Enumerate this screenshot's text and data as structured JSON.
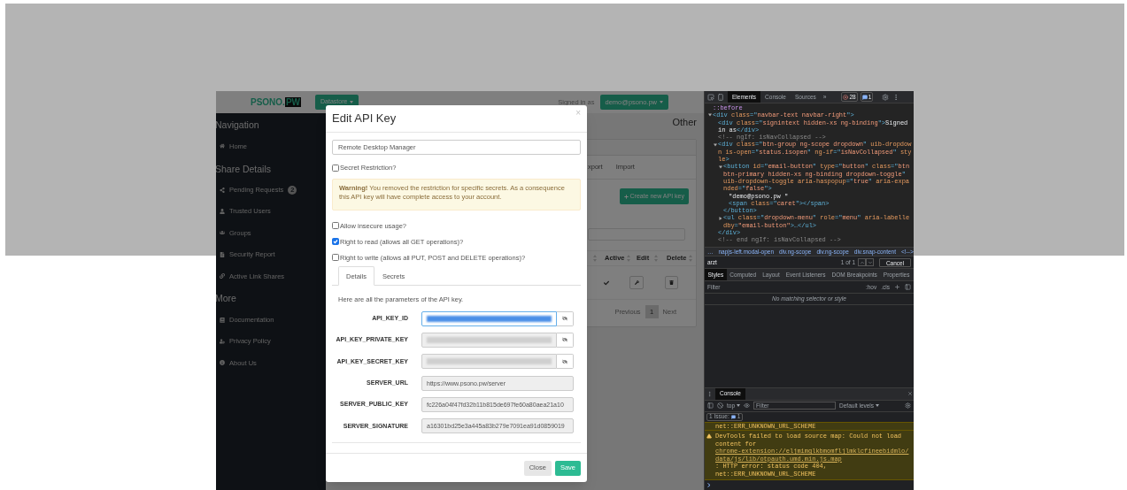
{
  "app": {
    "navbar": {
      "logo_text": "PSONO.",
      "logo_box": "PW",
      "datastore_button": "Datastore",
      "signed_in": "Signed in as",
      "user_button": "demo@psono.pw"
    },
    "sidebar": [
      {
        "title": "Navigation",
        "items": [
          {
            "label": "Home"
          }
        ]
      },
      {
        "title": "Share Details",
        "items": [
          {
            "label": "Pending Requests",
            "badge": "2"
          },
          {
            "label": "Trusted Users"
          },
          {
            "label": "Groups"
          },
          {
            "label": "Security Report"
          },
          {
            "label": "Active Link Shares"
          }
        ]
      },
      {
        "title": "More",
        "items": [
          {
            "label": "Documentation"
          },
          {
            "label": "Privacy Policy"
          },
          {
            "label": "About Us"
          }
        ]
      }
    ],
    "main": {
      "heading": "Other",
      "tabs": [
        "xport",
        "Import"
      ],
      "create_button": "Create new API key",
      "columns": [
        "Active",
        "Edit",
        "Delete"
      ],
      "rows": [
        {
          "active": true
        }
      ],
      "previous": "Previous",
      "page": "1",
      "next": "Next"
    }
  },
  "modal": {
    "title": "Edit API Key",
    "close": "×",
    "name_value": "Remote Desktop Manager",
    "secret_restriction": {
      "label": "Secret Restriction?",
      "checked": false
    },
    "warning": "**Warning!** You removed the restriction for specific secrets. As a consequence this API key will have complete access to your account.",
    "permissions": [
      {
        "label": "Allow insecure usage?",
        "checked": false
      },
      {
        "label": "Right to read (allows all GET operations)?",
        "checked": true
      },
      {
        "label": "Right to write (allows all PUT, POST and DELETE operations)?",
        "checked": false
      }
    ],
    "tabs": [
      {
        "label": "Details",
        "selected": true
      },
      {
        "label": "Secrets",
        "selected": false
      }
    ],
    "intro": "Here are all the parameters of the API key.",
    "params": [
      {
        "label": "API_KEY_ID",
        "kind": "hidden",
        "highlighted": true
      },
      {
        "label": "API_KEY_PRIVATE_KEY",
        "kind": "hidden",
        "highlighted": false
      },
      {
        "label": "API_KEY_SECRET_KEY",
        "kind": "hidden",
        "highlighted": false
      },
      {
        "label": "SERVER_URL",
        "kind": "text",
        "value": "https://www.psono.pw/server"
      },
      {
        "label": "SERVER_PUBLIC_KEY",
        "kind": "text",
        "value": "fc226a04f47fd32b11b815de697fe60a80aea21a10"
      },
      {
        "label": "SERVER_SIGNATURE",
        "kind": "text",
        "value": "a16301bd25e3a445a83b279e7091ea91d0859019"
      }
    ],
    "buttons": [
      {
        "label": "Close",
        "kind": "default"
      },
      {
        "label": "Save",
        "kind": "primary"
      }
    ]
  },
  "devtools": {
    "tabs": [
      {
        "label": "Elements",
        "selected": true
      },
      {
        "label": "Console",
        "selected": false
      },
      {
        "label": "Sources",
        "selected": false
      }
    ],
    "more": "»",
    "errors": "28",
    "messages": "1",
    "dom": [
      {
        "segs": [
          {
            "kind": "pseudo",
            "t": "::before"
          }
        ]
      },
      {
        "expanded": true,
        "segs": [
          {
            "kind": "tag",
            "t": "<div "
          },
          {
            "kind": "attr",
            "t": "class"
          },
          {
            "kind": "tag",
            "t": "=\""
          },
          {
            "kind": "val",
            "t": "navbar-text navbar-right"
          },
          {
            "kind": "tag",
            "t": "\">"
          }
        ],
        "children": [
          {
            "segs": [
              {
                "kind": "tag",
                "t": "<div "
              },
              {
                "kind": "attr",
                "t": "class"
              },
              {
                "kind": "tag",
                "t": "=\""
              },
              {
                "kind": "val",
                "t": "signintext hidden-xs ng-binding"
              },
              {
                "kind": "tag",
                "t": "\">"
              },
              {
                "kind": "text",
                "t": "Signed in as"
              },
              {
                "kind": "tag",
                "t": "</div>"
              }
            ]
          },
          {
            "segs": [
              {
                "kind": "comment",
                "t": "<!-- ngIf: isNavCollapsed -->"
              }
            ]
          },
          {
            "expanded": true,
            "segs": [
              {
                "kind": "tag",
                "t": "<div "
              },
              {
                "kind": "attr",
                "t": "class"
              },
              {
                "kind": "tag",
                "t": "=\""
              },
              {
                "kind": "val",
                "t": "btn-group ng-scope dropdown"
              },
              {
                "kind": "tag",
                "t": "\" "
              },
              {
                "kind": "attr",
                "t": "uib-dropdown is-open"
              },
              {
                "kind": "tag",
                "t": "=\""
              },
              {
                "kind": "val",
                "t": "status.isopen"
              },
              {
                "kind": "tag",
                "t": "\" "
              },
              {
                "kind": "attr",
                "t": "ng-if"
              },
              {
                "kind": "tag",
                "t": "=\""
              },
              {
                "kind": "val",
                "t": "isNavCollapsed"
              },
              {
                "kind": "tag",
                "t": "\" "
              },
              {
                "kind": "attr",
                "t": "style"
              },
              {
                "kind": "tag",
                "t": ">"
              }
            ],
            "children": [
              {
                "expanded": true,
                "segs": [
                  {
                    "kind": "tag",
                    "t": "<button "
                  },
                  {
                    "kind": "attr",
                    "t": "id"
                  },
                  {
                    "kind": "tag",
                    "t": "=\""
                  },
                  {
                    "kind": "val",
                    "t": "email-button"
                  },
                  {
                    "kind": "tag",
                    "t": "\" "
                  },
                  {
                    "kind": "attr",
                    "t": "type"
                  },
                  {
                    "kind": "tag",
                    "t": "=\""
                  },
                  {
                    "kind": "val",
                    "t": "button"
                  },
                  {
                    "kind": "tag",
                    "t": "\" "
                  },
                  {
                    "kind": "attr",
                    "t": "class"
                  },
                  {
                    "kind": "tag",
                    "t": "=\""
                  },
                  {
                    "kind": "val",
                    "t": "btn btn-primary hidden-xs ng-binding dropdown-toggle"
                  },
                  {
                    "kind": "tag",
                    "t": "\" "
                  },
                  {
                    "kind": "attr",
                    "t": "uib-dropdown-toggle aria-haspopup"
                  },
                  {
                    "kind": "tag",
                    "t": "=\""
                  },
                  {
                    "kind": "val",
                    "t": "true"
                  },
                  {
                    "kind": "tag",
                    "t": "\" "
                  },
                  {
                    "kind": "attr",
                    "t": "aria-expanded"
                  },
                  {
                    "kind": "tag",
                    "t": "=\""
                  },
                  {
                    "kind": "val",
                    "t": "false"
                  },
                  {
                    "kind": "tag",
                    "t": "\">"
                  }
                ],
                "children": [
                  {
                    "segs": [
                      {
                        "kind": "text",
                        "t": "\"demo@psono.pw \""
                      }
                    ]
                  },
                  {
                    "segs": [
                      {
                        "kind": "tag",
                        "t": "<span "
                      },
                      {
                        "kind": "attr",
                        "t": "class"
                      },
                      {
                        "kind": "tag",
                        "t": "=\""
                      },
                      {
                        "kind": "val",
                        "t": "caret"
                      },
                      {
                        "kind": "tag",
                        "t": "\"></span>"
                      }
                    ]
                  }
                ],
                "close": [
                  {
                    "kind": "tag",
                    "t": "</button>"
                  }
                ]
              },
              {
                "expanded": false,
                "segs": [
                  {
                    "kind": "tag",
                    "t": "<ul "
                  },
                  {
                    "kind": "attr",
                    "t": "class"
                  },
                  {
                    "kind": "tag",
                    "t": "=\""
                  },
                  {
                    "kind": "val",
                    "t": "dropdown-menu"
                  },
                  {
                    "kind": "tag",
                    "t": "\" "
                  },
                  {
                    "kind": "attr",
                    "t": "role"
                  },
                  {
                    "kind": "tag",
                    "t": "=\""
                  },
                  {
                    "kind": "val",
                    "t": "menu"
                  },
                  {
                    "kind": "tag",
                    "t": "\" "
                  },
                  {
                    "kind": "attr",
                    "t": "aria-labelledby"
                  },
                  {
                    "kind": "tag",
                    "t": "="
                  },
                  {
                    "kind": "val",
                    "t": "\"email-button\""
                  },
                  {
                    "kind": "tag",
                    "t": ">…</ul>"
                  }
                ]
              }
            ],
            "close": [
              {
                "kind": "tag",
                "t": "</div>"
              }
            ]
          },
          {
            "segs": [
              {
                "kind": "comment",
                "t": "<!-- end ngIf: isNavCollapsed -->"
              }
            ]
          }
        ]
      }
    ],
    "breadcrumbs": [
      "…",
      "napjs-left.modal-open",
      "div.ng-scope",
      "div.ng-scope",
      "div.snap-content",
      "<!-->"
    ],
    "search": {
      "value": "arzt",
      "count": "1 of 1",
      "cancel": "Cancel"
    },
    "style_tabs": [
      {
        "label": "Styles",
        "selected": true
      },
      {
        "label": "Computed",
        "selected": false
      },
      {
        "label": "Layout",
        "selected": false
      },
      {
        "label": "Event Listeners",
        "selected": false
      },
      {
        "label": "DOM Breakpoints",
        "selected": false
      },
      {
        "label": "Properties",
        "selected": false
      }
    ],
    "filter": {
      "placeholder": "Filter"
    },
    "hov": ":hov",
    "cls": ".cls",
    "empty": "No matching selector or style",
    "drawer": {
      "tab": "Console",
      "context": "top",
      "filter": {
        "placeholder": "Filter"
      },
      "levels": "Default levels",
      "issues": "1 Issue:",
      "issues_count": "1",
      "messages": [
        {
          "kind": "tail",
          "text": "net::ERR_UNKNOWN_URL_SCHEME"
        },
        {
          "kind": "warning",
          "text": "DevTools failed to load source map: Could not load content for",
          "link": "chrome-extension://eljmimglkbmomfljlmklcfineebidmlo/data/js/lib/otpauth.umd.min.js.map",
          "tail": ": HTTP error: status code 404, net::ERR_UNKNOWN_URL_SCHEME"
        }
      ]
    }
  }
}
